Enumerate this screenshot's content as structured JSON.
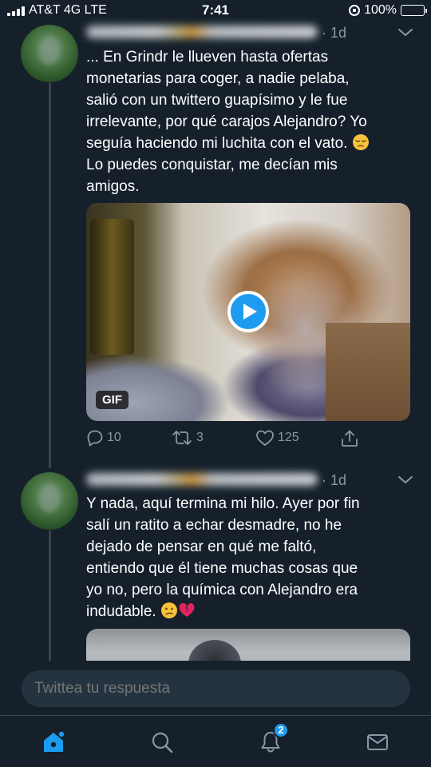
{
  "status_bar": {
    "carrier": "AT&T 4G  LTE",
    "time": "7:41",
    "battery": "100%",
    "battery_level": 1.0
  },
  "tweets": [
    {
      "timestamp": "· 1d",
      "text": "... En Grindr le llueven hasta ofertas monetarias para coger, a nadie pelaba, salió con un twittero guapísimo y le fue irrelevante, por qué carajos Alejandro? Yo seguía haciendo mi luchita con el vato. 😔\nLo puedes conquistar, me decían mis amigos.",
      "text_before_emoji": "... En Grindr le llueven hasta ofertas\nmonetarias para coger, a nadie pelaba,\nsalió con un twittero guapísimo y le fue\nirrelevante, por qué carajos Alejandro? Yo\nseguía haciendo mi luchita con el vato. ",
      "text_after_emoji": "\nLo puedes conquistar, me decían mis\namigos.",
      "emoji": "pensive-face",
      "media_badge": "GIF",
      "replies": "10",
      "retweets": "3",
      "likes": "125"
    },
    {
      "timestamp": "· 1d",
      "text": "Y nada, aquí termina mi hilo. Ayer por fin salí un ratito a echar desmadre, no he dejado de pensar en qué me faltó, entiendo que él tiene muchas cosas que yo no, pero la química con Alejandro era indudable. 😕💔",
      "text_before_emoji": "Y nada, aquí termina mi hilo. Ayer por fin\nsalí un ratito a echar desmadre, no he\ndejado de pensar en qué me faltó,\nentiendo que él tiene muchas cosas que\nyo no, pero la química con Alejandro era\nindudable. ",
      "emoji": [
        "confused-face",
        "broken-heart"
      ]
    }
  ],
  "reply": {
    "placeholder": "Twittea tu respuesta"
  },
  "tab_bar": {
    "items": [
      "home-icon",
      "search-icon",
      "bell-icon",
      "mail-icon"
    ],
    "notifications_badge": "2"
  },
  "colors": {
    "background": "#15202b",
    "accent": "#1d9bf0",
    "muted": "#8899a6",
    "heart_broken": "#e0245e"
  }
}
